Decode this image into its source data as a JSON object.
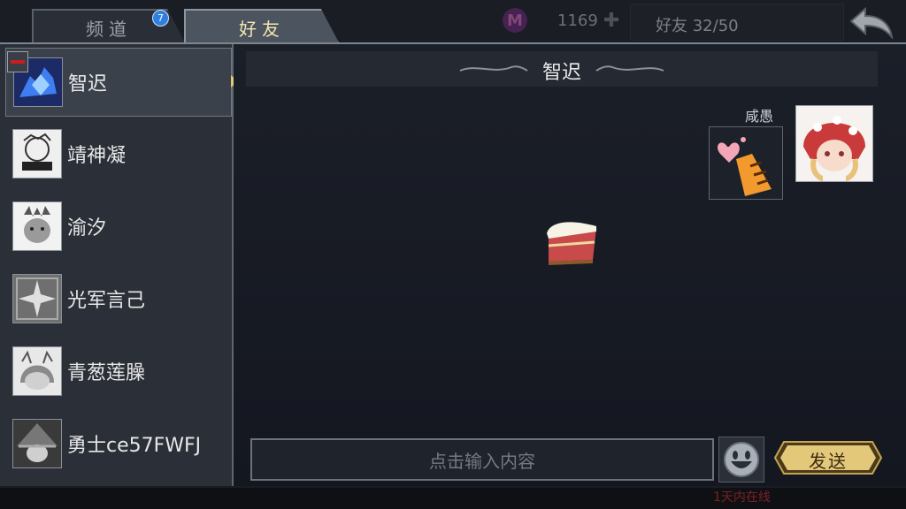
{
  "tabs": [
    {
      "label": "频道",
      "badge": "7"
    },
    {
      "label": "好友"
    }
  ],
  "currency": {
    "icon": "m-currency-icon",
    "value": "1169"
  },
  "friend_count": "好友 32/50",
  "friends": [
    {
      "name": "智迟",
      "avatar": "blue-dragon-avatar"
    },
    {
      "name": "靖神凝",
      "avatar": "sketch-character-avatar"
    },
    {
      "name": "渝汐",
      "avatar": "horned-monster-avatar"
    },
    {
      "name": "光军言己",
      "avatar": "star-emblem-avatar"
    },
    {
      "name": "青葱莲臊",
      "avatar": "hooded-girl-avatar"
    },
    {
      "name": "勇士ce57FWFJ",
      "avatar": "witch-hat-avatar"
    }
  ],
  "chat": {
    "title": "智迟",
    "sender": "咸愚",
    "message_sticker": "heart-tiger-paw-sticker",
    "center_sticker": "cake-slice-sticker"
  },
  "input": {
    "placeholder": "点击输入内容"
  },
  "send_label": "发送",
  "footer": {
    "online_text": "1天内在线"
  },
  "colors": {
    "accent_gold": "#e3c87a",
    "badge_blue": "#2f7fe0",
    "offline_red": "#c81e1e"
  }
}
